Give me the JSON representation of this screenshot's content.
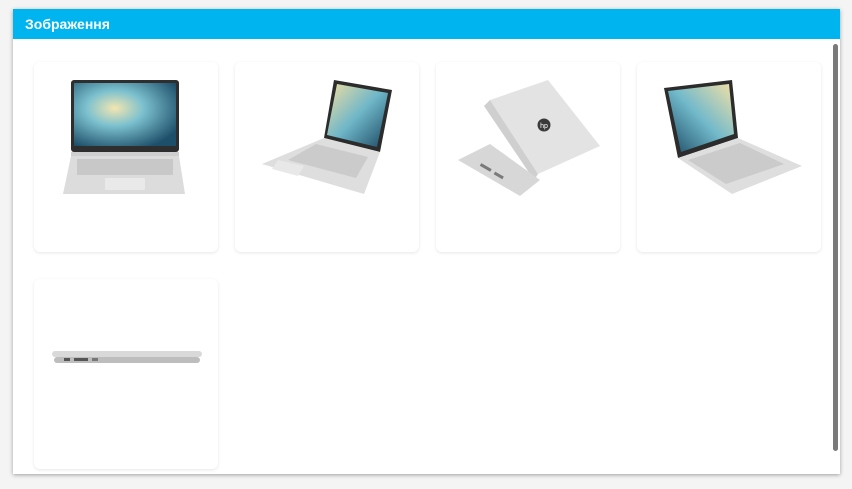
{
  "dialog": {
    "title": "Зображення"
  },
  "gallery": {
    "images": [
      {
        "view": "front",
        "icon": "laptop-front"
      },
      {
        "view": "angled-left",
        "icon": "laptop-angled"
      },
      {
        "view": "back",
        "icon": "laptop-back"
      },
      {
        "view": "angled-right",
        "icon": "laptop-angled"
      },
      {
        "view": "side-closed",
        "icon": "laptop-side"
      }
    ]
  },
  "colors": {
    "header": "#00b4ef",
    "scrollbar": "#7a7a7a"
  }
}
